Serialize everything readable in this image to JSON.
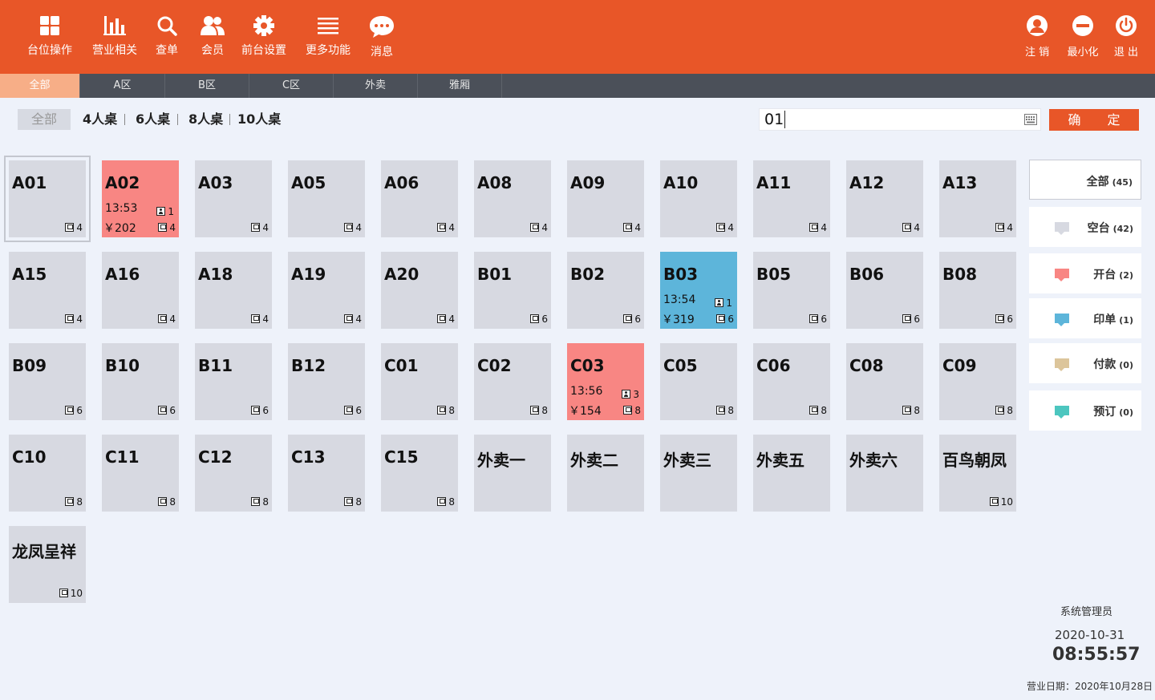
{
  "toolbar": {
    "items": [
      {
        "label": "台位操作",
        "icon": "grid-icon"
      },
      {
        "label": "营业相关",
        "icon": "bar-chart-icon"
      },
      {
        "label": "查单",
        "icon": "search-icon"
      },
      {
        "label": "会员",
        "icon": "members-icon"
      },
      {
        "label": "前台设置",
        "icon": "gear-icon"
      },
      {
        "label": "更多功能",
        "icon": "menu-icon"
      },
      {
        "label": "消息",
        "icon": "chat-icon"
      }
    ],
    "right": [
      {
        "label": "注 销",
        "icon": "user-logout-icon"
      },
      {
        "label": "最小化",
        "icon": "minimize-icon"
      },
      {
        "label": "退 出",
        "icon": "power-icon"
      }
    ]
  },
  "areas": [
    "全部",
    "A区",
    "B区",
    "C区",
    "外卖",
    "雅厢"
  ],
  "filters": [
    "全部",
    "4人桌",
    "6人桌",
    "8人桌",
    "10人桌"
  ],
  "search": {
    "value": "01",
    "confirm_label": "确 定"
  },
  "tables": [
    {
      "name": "A01",
      "seats": "4",
      "status": "free"
    },
    {
      "name": "A02",
      "seats": "4",
      "status": "open",
      "time": "13:53",
      "guests": "1",
      "amount": "￥202"
    },
    {
      "name": "A03",
      "seats": "4",
      "status": "free"
    },
    {
      "name": "A05",
      "seats": "4",
      "status": "free"
    },
    {
      "name": "A06",
      "seats": "4",
      "status": "free"
    },
    {
      "name": "A08",
      "seats": "4",
      "status": "free"
    },
    {
      "name": "A09",
      "seats": "4",
      "status": "free"
    },
    {
      "name": "A10",
      "seats": "4",
      "status": "free"
    },
    {
      "name": "A11",
      "seats": "4",
      "status": "free"
    },
    {
      "name": "A12",
      "seats": "4",
      "status": "free"
    },
    {
      "name": "A13",
      "seats": "4",
      "status": "free"
    },
    {
      "name": "A15",
      "seats": "4",
      "status": "free"
    },
    {
      "name": "A16",
      "seats": "4",
      "status": "free"
    },
    {
      "name": "A18",
      "seats": "4",
      "status": "free"
    },
    {
      "name": "A19",
      "seats": "4",
      "status": "free"
    },
    {
      "name": "A20",
      "seats": "4",
      "status": "free"
    },
    {
      "name": "B01",
      "seats": "6",
      "status": "free"
    },
    {
      "name": "B02",
      "seats": "6",
      "status": "free"
    },
    {
      "name": "B03",
      "seats": "6",
      "status": "printed",
      "time": "13:54",
      "guests": "1",
      "amount": "￥319"
    },
    {
      "name": "B05",
      "seats": "6",
      "status": "free"
    },
    {
      "name": "B06",
      "seats": "6",
      "status": "free"
    },
    {
      "name": "B08",
      "seats": "6",
      "status": "free"
    },
    {
      "name": "B09",
      "seats": "6",
      "status": "free"
    },
    {
      "name": "B10",
      "seats": "6",
      "status": "free"
    },
    {
      "name": "B11",
      "seats": "6",
      "status": "free"
    },
    {
      "name": "B12",
      "seats": "6",
      "status": "free"
    },
    {
      "name": "C01",
      "seats": "8",
      "status": "free"
    },
    {
      "name": "C02",
      "seats": "8",
      "status": "free"
    },
    {
      "name": "C03",
      "seats": "8",
      "status": "open",
      "time": "13:56",
      "guests": "3",
      "amount": "￥154"
    },
    {
      "name": "C05",
      "seats": "8",
      "status": "free"
    },
    {
      "name": "C06",
      "seats": "8",
      "status": "free"
    },
    {
      "name": "C08",
      "seats": "8",
      "status": "free"
    },
    {
      "name": "C09",
      "seats": "8",
      "status": "free"
    },
    {
      "name": "C10",
      "seats": "8",
      "status": "free"
    },
    {
      "name": "C11",
      "seats": "8",
      "status": "free"
    },
    {
      "name": "C12",
      "seats": "8",
      "status": "free"
    },
    {
      "name": "C13",
      "seats": "8",
      "status": "free"
    },
    {
      "name": "C15",
      "seats": "8",
      "status": "free"
    },
    {
      "name": "外卖一",
      "seats": "",
      "status": "free"
    },
    {
      "name": "外卖二",
      "seats": "",
      "status": "free"
    },
    {
      "name": "外卖三",
      "seats": "",
      "status": "free"
    },
    {
      "name": "外卖五",
      "seats": "",
      "status": "free"
    },
    {
      "name": "外卖六",
      "seats": "",
      "status": "free"
    },
    {
      "name": "百鸟朝凤",
      "seats": "10",
      "status": "free"
    },
    {
      "name": "龙凤呈祥",
      "seats": "10",
      "status": "free"
    }
  ],
  "legend": [
    {
      "label": "全部",
      "count": "(45)",
      "color": ""
    },
    {
      "label": "空台",
      "count": "(42)",
      "color": "#d7d9e1"
    },
    {
      "label": "开台",
      "count": "(2)",
      "color": "#f88683"
    },
    {
      "label": "印单",
      "count": "(1)",
      "color": "#5db5da"
    },
    {
      "label": "付款",
      "count": "(0)",
      "color": "#dcc59b"
    },
    {
      "label": "预订",
      "count": "(0)",
      "color": "#4cc6bf"
    }
  ],
  "status": {
    "operator": "系统管理员",
    "date": "2020-10-31",
    "time": "08:55:57",
    "business_date": "营业日期：2020年10月28日"
  }
}
